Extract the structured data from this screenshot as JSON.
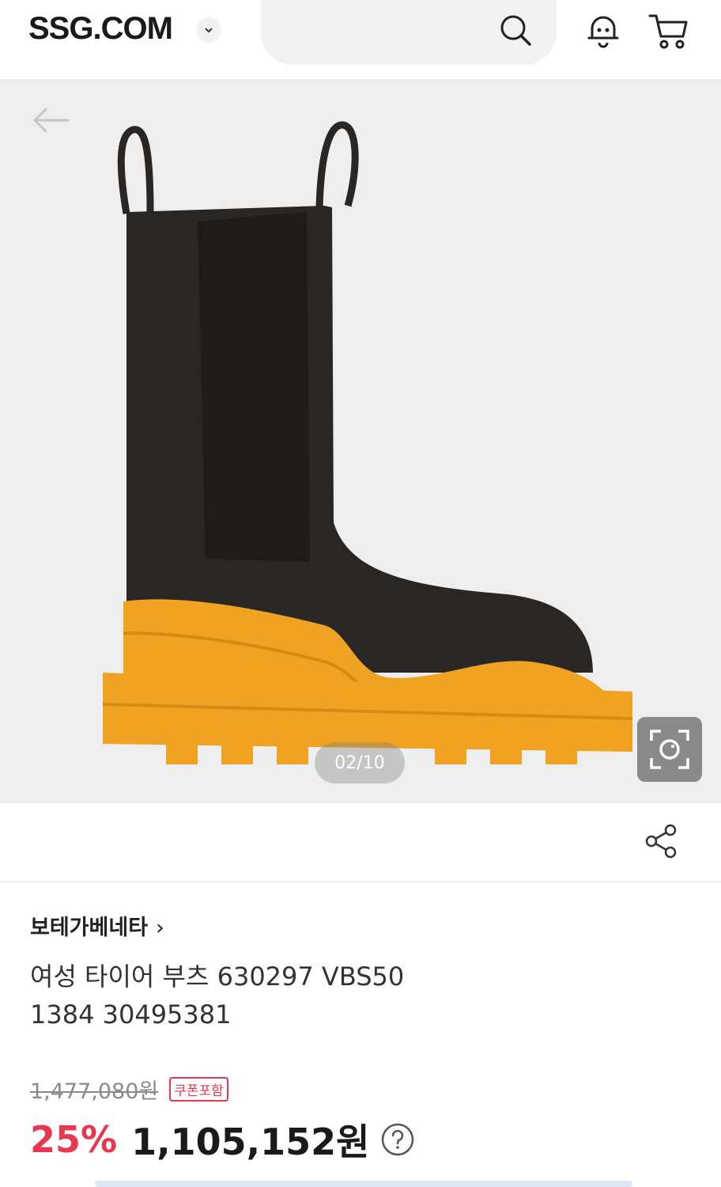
{
  "header": {
    "logo": "SSG.COM",
    "icons": [
      "close-icon",
      "chevron-down-icon",
      "search-icon",
      "bell-icon",
      "cart-icon"
    ]
  },
  "hero": {
    "pager": "02/10",
    "icons": [
      "back-arrow-icon",
      "camera-lens-icon"
    ],
    "colors": {
      "background": "#eeeeee",
      "boot_body": "#2a2623",
      "sole": "#f0a322"
    }
  },
  "share": {
    "icon": "share-icon"
  },
  "product": {
    "brand": "보테가베네타",
    "brand_chevron": "›",
    "title_line1": "여성 타이어 부츠 630297 VBS50",
    "title_line2": "1384 30495381",
    "original_price": "1,477,080원",
    "coupon_badge": "쿠폰포함",
    "discount": "25%",
    "sale_price": "1,105,152원"
  },
  "colors": {
    "accent": "#e8384f"
  }
}
